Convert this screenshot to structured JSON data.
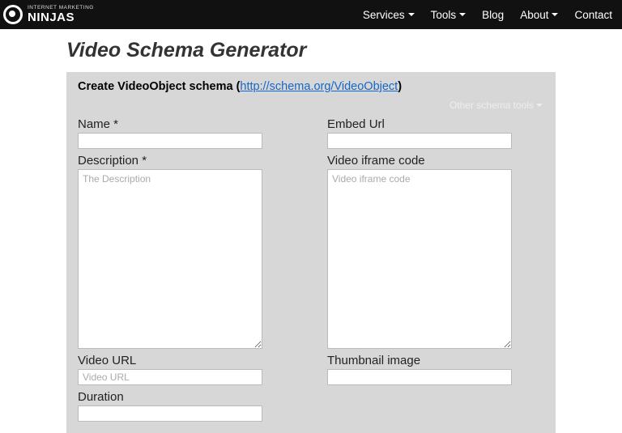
{
  "brand": {
    "sub": "INTERNET MARKETING",
    "main": "NINJAS"
  },
  "nav": {
    "services": "Services",
    "tools": "Tools",
    "blog": "Blog",
    "about": "About",
    "contact": "Contact"
  },
  "page": {
    "title": "Video Schema Generator"
  },
  "panel": {
    "lead": "Create VideoObject schema (",
    "link_text": "http://schema.org/VideoObject",
    "tail": ")",
    "other_tools": "Other schema tools"
  },
  "fields": {
    "name_label": "Name *",
    "description_label": "Description *",
    "description_placeholder": "The Description",
    "video_url_label": "Video URL",
    "video_url_placeholder": "Video URL",
    "duration_label": "Duration",
    "embed_url_label": "Embed Url",
    "iframe_label": "Video iframe code",
    "iframe_placeholder": "Video iframe code",
    "thumbnail_label": "Thumbnail image"
  }
}
